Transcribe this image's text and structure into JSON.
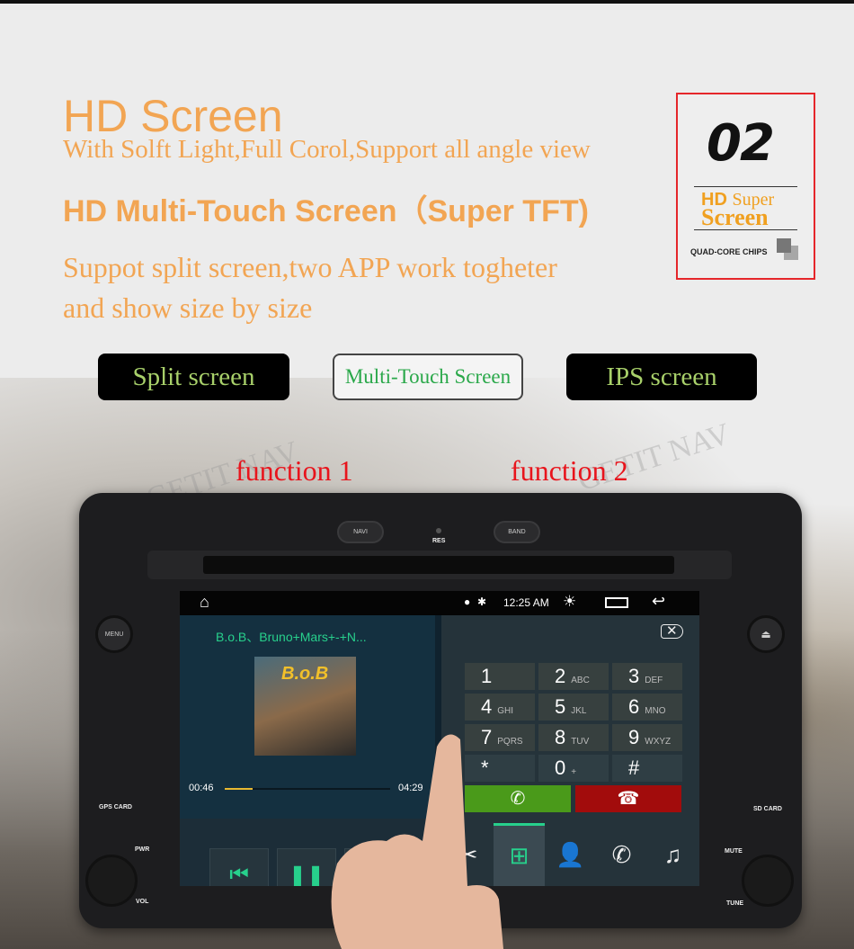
{
  "headline": {
    "title": "HD Screen",
    "subtitle": "With Solft Light,Full Corol,Support all angle view",
    "feature": "HD Multi-Touch Screen（Super TFT)",
    "description_line1": "Suppot split screen,two APP work togheter",
    "description_line2": "and show size by size"
  },
  "badge": {
    "number": "02",
    "line1_bold": "HD",
    "line1_rest": "Super",
    "line2": "Screen",
    "chips": "QUAD-CORE CHIPS"
  },
  "pills": [
    {
      "label": "Split screen",
      "style": "dark"
    },
    {
      "label": "Multi-Touch Screen",
      "style": "light"
    },
    {
      "label": "IPS screen",
      "style": "dark"
    }
  ],
  "functions": [
    "function 1",
    "function 2"
  ],
  "watermark": "GETIT NAV",
  "device": {
    "top_buttons": [
      "NAVI",
      "RES",
      "BAND"
    ],
    "left_labels": {
      "menu": "MENU",
      "card": "GPS CARD",
      "pwr": "PWR",
      "vol": "VOL"
    },
    "right_labels": {
      "card": "SD CARD",
      "mute": "MUTE",
      "tune": "TUNE"
    }
  },
  "screen": {
    "status": {
      "time": "12:25 AM",
      "icons": [
        "home-icon",
        "location-icon",
        "bluetooth-icon",
        "brightness-icon",
        "recent-apps-icon",
        "back-icon"
      ]
    },
    "music": {
      "track": "B.o.B、Bruno+Mars+-+N...",
      "elapsed": "00:46",
      "total": "04:29",
      "progress": 0.17,
      "album_text": "B.o.B",
      "accent": "#27d08c"
    },
    "dialer": {
      "keys": [
        {
          "digit": "1",
          "letters": ""
        },
        {
          "digit": "2",
          "letters": "ABC"
        },
        {
          "digit": "3",
          "letters": "DEF"
        },
        {
          "digit": "4",
          "letters": "GHI"
        },
        {
          "digit": "5",
          "letters": "JKL"
        },
        {
          "digit": "6",
          "letters": "MNO"
        },
        {
          "digit": "7",
          "letters": "PQRS"
        },
        {
          "digit": "8",
          "letters": "TUV"
        },
        {
          "digit": "9",
          "letters": "WXYZ"
        },
        {
          "digit": "*",
          "letters": ""
        },
        {
          "digit": "0",
          "letters": "+"
        },
        {
          "digit": "#",
          "letters": ""
        }
      ],
      "call_color": "#4a9a1a",
      "hangup_color": "#a20c0c",
      "tabs": [
        "link-icon",
        "dialpad-icon",
        "contacts-icon",
        "call-log-icon",
        "music-icon"
      ],
      "active_tab": 1
    }
  }
}
